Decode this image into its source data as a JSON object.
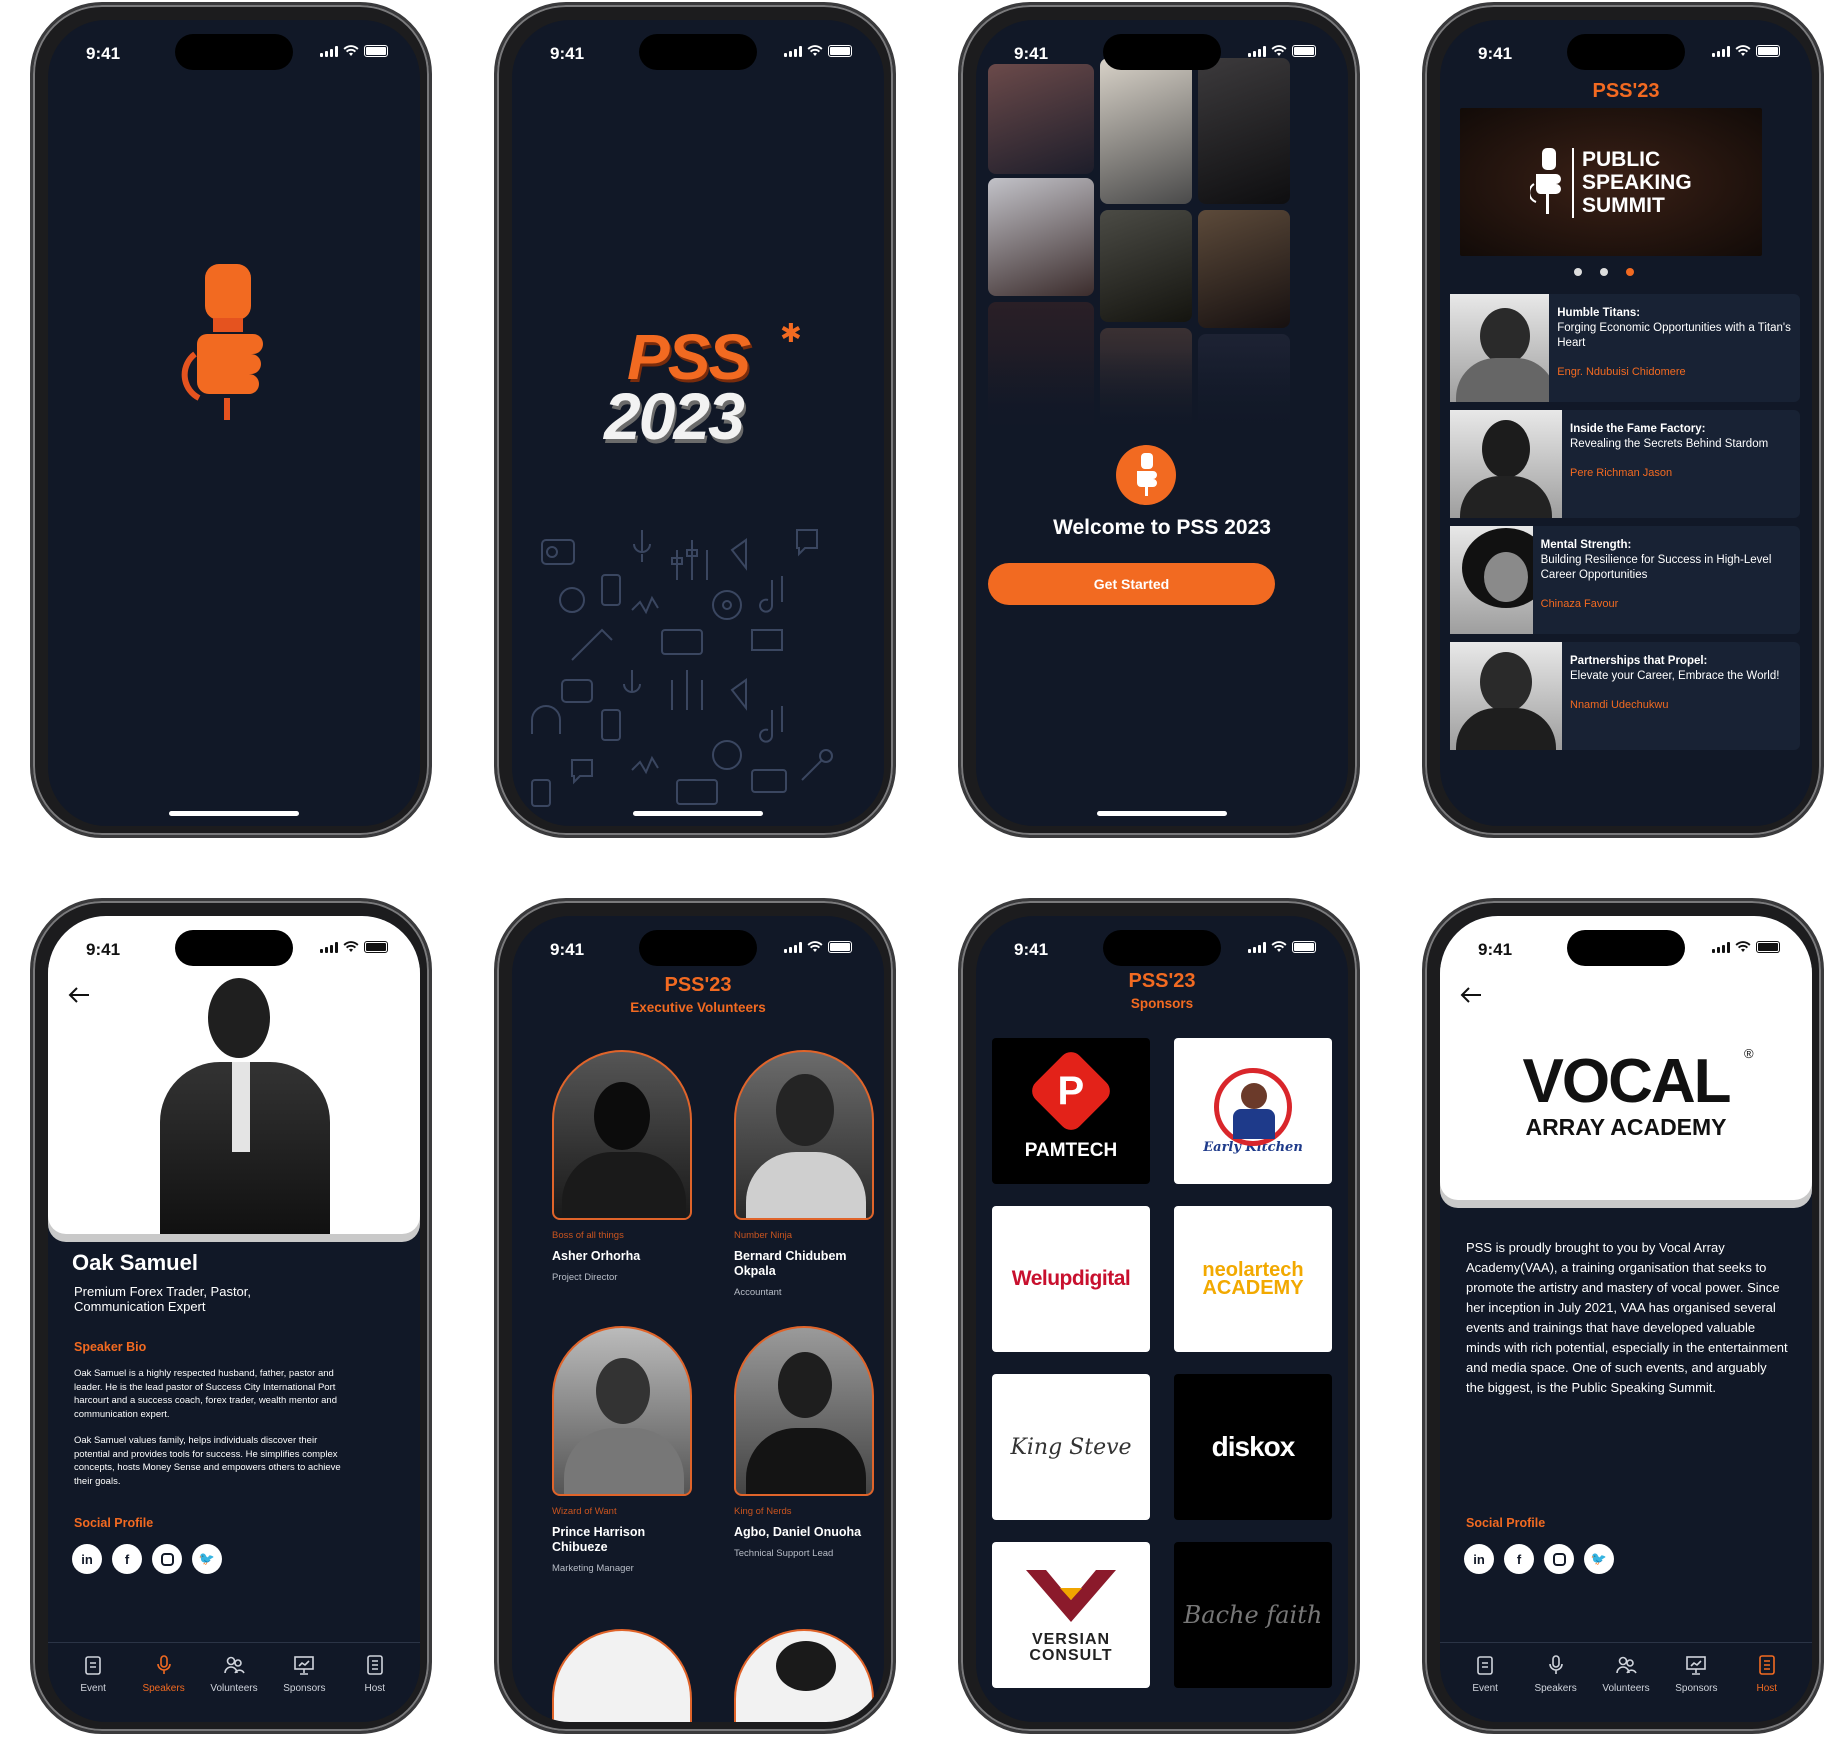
{
  "status_time": "9:41",
  "accent_color": "#f26a21",
  "background_color": "#111827",
  "splash2": {
    "logo_top": "PSS",
    "logo_bottom": "2023"
  },
  "welcome": {
    "title": "Welcome to PSS 2023",
    "button": "Get Started"
  },
  "event": {
    "header": "PSS'23",
    "banner": [
      "PUBLIC",
      "SPEAKING",
      "SUMMIT"
    ],
    "talks": [
      {
        "title": "Humble Titans:",
        "subtitle": "Forging Economic Opportunities with a Titan's Heart",
        "speaker": "Engr. Ndubuisi Chidomere"
      },
      {
        "title": "Inside the Fame Factory:",
        "subtitle": "Revealing the Secrets Behind Stardom",
        "speaker": "Pere Richman Jason"
      },
      {
        "title": "Mental Strength:",
        "subtitle": "Building Resilience for Success in High-Level Career Opportunities",
        "speaker": "Chinaza Favour"
      },
      {
        "title": "Partnerships that Propel:",
        "subtitle": "Elevate your Career, Embrace the World!",
        "speaker": "Nnamdi Udechukwu"
      }
    ]
  },
  "speaker": {
    "name": "Oak Samuel",
    "titles": "Premium Forex Trader, Pastor, Communication Expert",
    "bio_heading": "Speaker Bio",
    "bio_p1": "Oak Samuel is a highly respected husband, father, pastor and leader. He is the lead pastor of Success City International Port harcourt and a success coach, forex trader, wealth mentor and communication expert.",
    "bio_p2": "Oak Samuel values family, helps individuals discover their potential and provides tools for success. He simplifies complex concepts, hosts Money Sense and empowers others to achieve their goals.",
    "social_heading": "Social Profile"
  },
  "volunteers": {
    "header": "PSS'23",
    "subheader": "Executive Volunteers",
    "people": [
      {
        "role": "Boss of all things",
        "name": "Asher Orhorha",
        "position": "Project Director"
      },
      {
        "role": "Number Ninja",
        "name": "Bernard Chidubem Okpala",
        "position": "Accountant"
      },
      {
        "role": "Wizard of Want",
        "name": "Prince Harrison Chibueze",
        "position": "Marketing Manager"
      },
      {
        "role": "King of Nerds",
        "name": "Agbo, Daniel Onuoha",
        "position": "Technical Support Lead"
      }
    ]
  },
  "sponsors": {
    "header": "PSS'23",
    "subheader": "Sponsors",
    "items": [
      "PAMTECH",
      "Early Kitchen",
      "Welupdigital",
      "neolartech ACADEMY",
      "King Steve",
      "diskox",
      "VERSIAN CONSULT",
      "Bache faith"
    ]
  },
  "host": {
    "logo_line1": "VOCAL",
    "logo_line2": "ARRAY ACADEMY",
    "description": "PSS is proudly brought to you by Vocal Array Academy(VAA), a training organisation that seeks to promote the artistry and mastery of vocal power. Since her inception in July 2021, VAA has organised several events and trainings that have developed valuable minds with rich potential, especially in the entertainment and media space. One of such events, and arguably the biggest, is the Public Speaking Summit.",
    "social_heading": "Social Profile"
  },
  "tabs": [
    "Event",
    "Speakers",
    "Volunteers",
    "Sponsors",
    "Host"
  ],
  "social_icons": [
    "linkedin-icon",
    "facebook-icon",
    "instagram-icon",
    "twitter-icon"
  ]
}
